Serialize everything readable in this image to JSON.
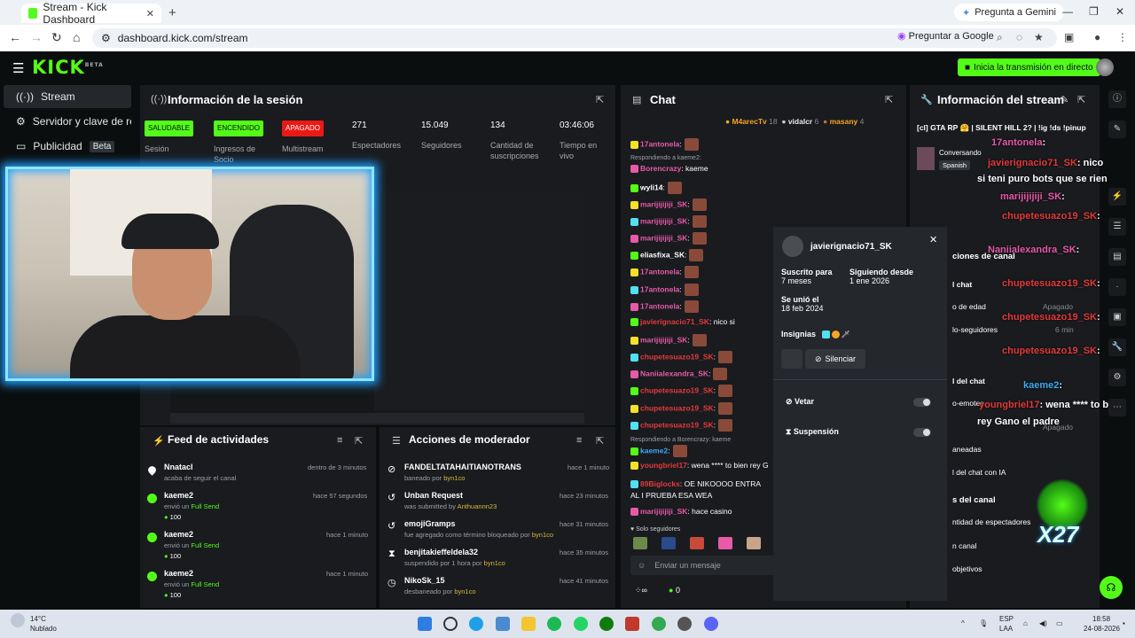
{
  "browser": {
    "tab_title": "Stream - Kick Dashboard",
    "gemini": "Pregunta a Gemini",
    "url": "dashboard.kick.com/stream",
    "ask_google": "Preguntar a Google"
  },
  "header": {
    "logo": "KICK",
    "logo_sup": "BETA",
    "go_live": "Inicia la transmisión en directo"
  },
  "sidebar": {
    "items": [
      {
        "label": "Stream"
      },
      {
        "label": "Servidor y clave de retran"
      },
      {
        "label": "Publicidad",
        "badge": "Beta"
      }
    ]
  },
  "session": {
    "title": "Información de la sesión",
    "stats": [
      {
        "value": "SALUDABLE",
        "label": "Sesión"
      },
      {
        "value": "ENCENDIDO",
        "label": "Ingresos de Socio"
      },
      {
        "value": "APAGADO",
        "label": "Multistream"
      },
      {
        "value": "271",
        "label": "Espectadores"
      },
      {
        "value": "15.049",
        "label": "Seguidores"
      },
      {
        "value": "134",
        "label": "Cantidad de suscripciones"
      },
      {
        "value": "03:46:06",
        "label": "Tiempo en vivo"
      }
    ]
  },
  "feed": {
    "title": "Feed de actividades",
    "items": [
      {
        "name": "Nnatacl",
        "action": "acaba de seguir el canal",
        "time": "dentro de 3 minutos"
      },
      {
        "name": "kaeme2",
        "action": "envió un",
        "item": "Full Send",
        "amount": "100",
        "time": "hace 57 segundos"
      },
      {
        "name": "kaeme2",
        "action": "envió un",
        "item": "Full Send",
        "amount": "100",
        "time": "hace 1 minuto"
      },
      {
        "name": "kaeme2",
        "action": "envió un",
        "item": "Full Send",
        "amount": "100",
        "time": "hace 1 minuto"
      }
    ]
  },
  "mod": {
    "title": "Acciones de moderador",
    "items": [
      {
        "name": "FANDELTATAHAITIANOTRANS",
        "action": "baneado por",
        "by": "byn1co",
        "time": "hace 1 minuto"
      },
      {
        "name": "Unban Request",
        "action": "was submitted by",
        "by": "Anthuannn23",
        "time": "hace 23 minutos"
      },
      {
        "name": "emojiGramps",
        "action": "fue agregado como término bloqueado por",
        "by": "byn1co",
        "time": "hace 31 minutos"
      },
      {
        "name": "benjitakieffeldela32",
        "action": "suspendido por 1 hora por",
        "by": "byn1co",
        "time": "hace 35 minutos"
      },
      {
        "name": "NikoSk_15",
        "action": "desbaneado por",
        "by": "byn1co",
        "time": "hace 41 minutos"
      }
    ]
  },
  "chat": {
    "title": "Chat",
    "top_gifters": [
      {
        "name": "M4arecTv",
        "count": "18"
      },
      {
        "name": "vidalcr",
        "count": "6"
      },
      {
        "name": "masany",
        "count": "4"
      }
    ],
    "lines": [
      {
        "user": "17antonela",
        "text": ":",
        "color": "#e85aa8"
      },
      {
        "reply": "Respondiendo a kaeme2:"
      },
      {
        "user": "Borencrazy",
        "text": ": kaeme",
        "color": "#e85aa8"
      },
      {
        "user": "wyli14",
        "text": ":",
        "color": "#ffffff"
      },
      {
        "user": "marijijijiji_SK",
        "text": ":",
        "color": "#e85aa8"
      },
      {
        "user": "marijijijiji_SK",
        "text": ":",
        "color": "#e85aa8"
      },
      {
        "user": "marijijijiji_SK",
        "text": ":",
        "color": "#e85aa8"
      },
      {
        "user": "eliasfixa_SK",
        "text": ":",
        "color": "#ffffff"
      },
      {
        "user": "17antonela",
        "text": ":",
        "color": "#e85aa8"
      },
      {
        "user": "17antonela",
        "text": ":",
        "color": "#e85aa8"
      },
      {
        "user": "17antonela",
        "text": ":",
        "color": "#e85aa8"
      },
      {
        "user": "javierignacio71_SK",
        "text": ": nico si",
        "color": "#e33a3a"
      },
      {
        "user": "marijijijiji_SK",
        "text": ":",
        "color": "#e85aa8"
      },
      {
        "user": "chupetesuazo19_SK",
        "text": ":",
        "color": "#e33a3a"
      },
      {
        "user": "Naniialexandra_SK",
        "text": ":",
        "color": "#e85aa8"
      },
      {
        "user": "chupetesuazo19_SK",
        "text": ":",
        "color": "#e33a3a"
      },
      {
        "user": "chupetesuazo19_SK",
        "text": ":",
        "color": "#e33a3a"
      },
      {
        "user": "chupetesuazo19_SK",
        "text": ":",
        "color": "#e33a3a"
      },
      {
        "reply": "Respondiendo a Borencrazy: kaeme"
      },
      {
        "user": "kaeme2",
        "text": ":",
        "color": "#3fa9f5"
      },
      {
        "user": "youngbriel17",
        "text": ": wena **** to bien rey G",
        "color": "#e33a3a"
      },
      {
        "user": "89Biglocks",
        "text": ": OE NIKOOOO ENTRA AL I PRUEBA ESA WEA",
        "color": "#e33a3a"
      },
      {
        "user": "marijijijiji_SK",
        "text": ": hace casino",
        "color": "#e85aa8"
      }
    ],
    "followers_only": "Solo seguidores",
    "input_placeholder": "Enviar un mensaje",
    "points": "0"
  },
  "user_card": {
    "username": "javierignacio71_SK",
    "sub_label": "Suscrito para",
    "sub_value": "7 meses",
    "follow_label": "Siguiendo desde",
    "follow_value": "1 ene 2026",
    "joined_label": "Se unió el",
    "joined_value": "18 feb 2024",
    "badges_label": "Insignias",
    "mute": "Silenciar",
    "ban": "Vetar",
    "timeout": "Suspensión"
  },
  "stream_info": {
    "title": "Información del stream",
    "stream_title": "[cl] GTA RP 🤗 | SILENT HILL 2? | !ig !ds !pinup",
    "category": "Conversando",
    "language": "Spanish",
    "settings": [
      "ciones de canal",
      "l chat",
      "o de edad",
      "lo-seguidores",
      "Apagado",
      "6 min",
      "l del chat",
      "o-emotes",
      "Apagado",
      "aneadas",
      "l del chat con IA",
      "s del canal",
      "ntidad de espectadores",
      "n canal",
      "objetivos"
    ]
  },
  "overlay": {
    "lines": [
      {
        "user": "17antonela",
        "text": ":",
        "color": "#e85aa8"
      },
      {
        "user": "javierignacio71_SK",
        "text": ": nico",
        "color": "#e33a3a"
      },
      {
        "user": "",
        "text": "si teni puro bots que se rien",
        "color": "#ffffff"
      },
      {
        "user": "marijijijiji_SK",
        "text": ":",
        "color": "#e85aa8"
      },
      {
        "user": "chupetesuazo19_SK",
        "text": ":",
        "color": "#e33a3a"
      },
      {
        "user": "Naniialexandra_SK",
        "text": ":",
        "color": "#e85aa8"
      },
      {
        "user": "chupetesuazo19_SK",
        "text": ":",
        "color": "#e33a3a"
      },
      {
        "user": "chupetesuazo19_SK",
        "text": ":",
        "color": "#e33a3a"
      },
      {
        "user": "chupetesuazo19_SK",
        "text": ":",
        "color": "#e33a3a"
      },
      {
        "user": "kaeme2",
        "text": ":",
        "color": "#3fa9f5"
      },
      {
        "user": "youngbriel17",
        "text": ": wena **** to bien",
        "color": "#e33a3a"
      },
      {
        "user": "",
        "text": "rey Gano el padre",
        "color": "#ffffff"
      }
    ],
    "x27": "X27"
  },
  "system": {
    "weather_temp": "14°C",
    "weather_desc": "Nublado",
    "lang": "ESP",
    "lang2": "LAA",
    "time": "18:58",
    "date": "24-08-2026"
  }
}
